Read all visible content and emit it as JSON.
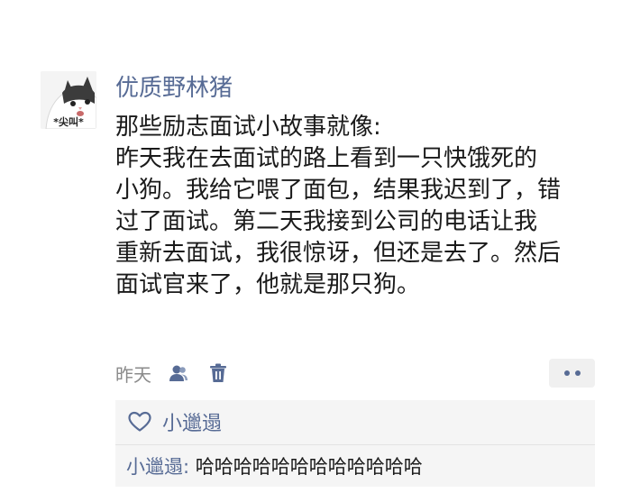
{
  "post": {
    "avatar_caption": "*尖叫*",
    "username": "优质野林猪",
    "content_lines": [
      "那些励志面试小故事就像:",
      "昨天我在去面试的路上看到一只快饿死的",
      "小狗。我给它喂了面包，结果我迟到了，错",
      "过了面试。第二天我接到公司的电话让我",
      "重新去面试，我很惊讶，但还是去了。然后",
      "面试官来了，他就是那只狗。"
    ],
    "time": "昨天",
    "icons": {
      "privacy": "person-icon",
      "delete": "trash-icon",
      "more": "more-dots-icon",
      "like": "heart-icon"
    }
  },
  "interactions": {
    "likes": [
      "小邋遢"
    ],
    "comments": [
      {
        "author": "小邋遢",
        "separator": ": ",
        "text": "哈哈哈哈哈哈哈哈哈哈哈哈"
      }
    ]
  },
  "colors": {
    "link": "#576b95",
    "text": "#1a1a1a",
    "muted": "#8a8a8a",
    "panel": "#f5f5f5"
  }
}
